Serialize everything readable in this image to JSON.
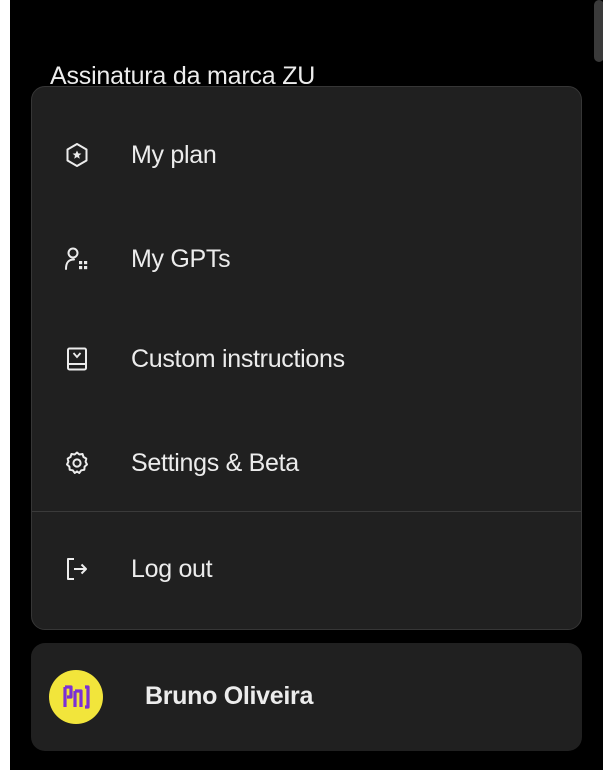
{
  "sidebar": {
    "partial_conversation": "",
    "conversation_title": "Assinatura da marca ZU"
  },
  "menu": {
    "items": [
      {
        "label": "My plan",
        "icon": "star-badge-icon"
      },
      {
        "label": "My GPTs",
        "icon": "user-grid-icon"
      },
      {
        "label": "Custom instructions",
        "icon": "book-icon"
      },
      {
        "label": "Settings & Beta",
        "icon": "gear-icon"
      },
      {
        "label": "Log out",
        "icon": "logout-icon"
      }
    ]
  },
  "user": {
    "name": "Bruno Oliveira",
    "avatar_color": "#f2e53b",
    "avatar_glyph_color": "#7b2fd6"
  },
  "colors": {
    "background": "#000000",
    "menu_background": "#202020",
    "text": "#ececec"
  }
}
